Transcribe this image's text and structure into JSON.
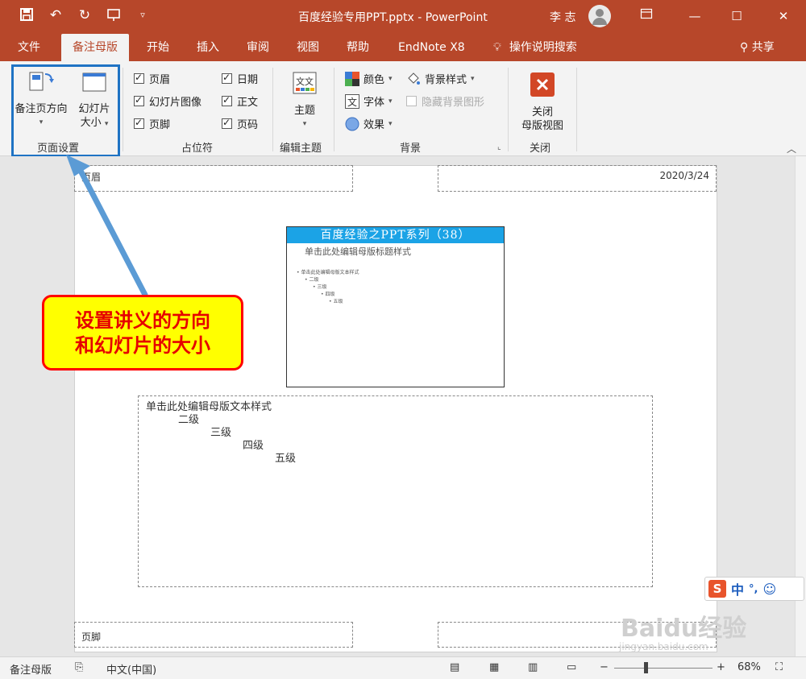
{
  "titlebar": {
    "title": "百度经验专用PPT.pptx  -  PowerPoint",
    "user": "李 志",
    "qat_icons": [
      "save-icon",
      "undo-icon",
      "redo-icon",
      "present-icon",
      "customize-icon"
    ]
  },
  "tabs": [
    {
      "label": "文件"
    },
    {
      "label": "备注母版"
    },
    {
      "label": "开始"
    },
    {
      "label": "插入"
    },
    {
      "label": "审阅"
    },
    {
      "label": "视图"
    },
    {
      "label": "帮助"
    },
    {
      "label": "EndNote X8"
    },
    {
      "label": "操作说明搜索"
    }
  ],
  "share_label": "共享",
  "ribbon": {
    "page_setup": {
      "notes_orientation": "备注页方向",
      "slide_size_line1": "幻灯片",
      "slide_size_line2": "大小",
      "group_label": "页面设置"
    },
    "placeholders": {
      "header": "页眉",
      "slide_image": "幻灯片图像",
      "footer": "页脚",
      "date": "日期",
      "body": "正文",
      "page_number": "页码",
      "group_label": "占位符"
    },
    "edit_theme": {
      "theme": "主题",
      "group_label": "编辑主题"
    },
    "background": {
      "colors": "颜色",
      "fonts": "字体",
      "effects": "效果",
      "bg_styles": "背景样式",
      "hide_bg": "隐藏背景图形",
      "group_label": "背景"
    },
    "close": {
      "line1": "关闭",
      "line2": "母版视图",
      "group_label": "关闭"
    }
  },
  "page": {
    "header": "页眉",
    "date": "2020/3/24",
    "footer": "页脚",
    "slide_banner": "百度经验之PPT系列（38）",
    "slide_title": "单击此处编辑母版标题样式",
    "slide_bullets": [
      "单击此处编辑母版文本样式",
      "二级",
      "三级",
      "四级",
      "五级"
    ],
    "body_levels": [
      "单击此处编辑母版文本样式",
      "二级",
      "三级",
      "四级",
      "五级"
    ]
  },
  "callout": {
    "line1": "设置讲义的方向",
    "line2": "和幻灯片的大小"
  },
  "statusbar": {
    "mode": "备注母版",
    "language": "中文(中国)",
    "zoom": "68%"
  },
  "ime": {
    "logo": "S",
    "mode": "中",
    "punct": "°,"
  },
  "watermark": {
    "brand": "Baidu经验",
    "url": "jingyan.baidu.com"
  },
  "colors": {
    "accent": "#b7472a",
    "highlight_border": "#1f73c4",
    "callout_fill": "#ffff00",
    "callout_text": "#e60000",
    "slide_banner": "#1ba3e6"
  }
}
